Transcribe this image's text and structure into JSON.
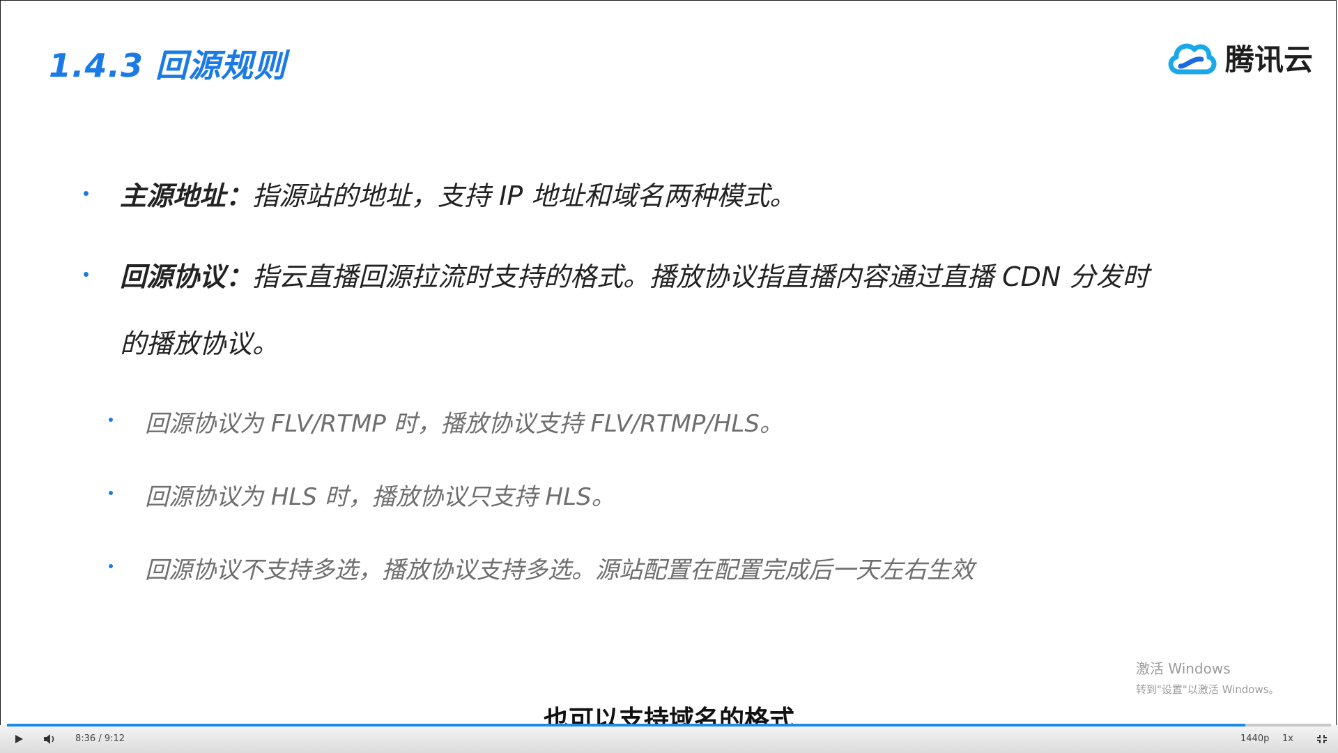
{
  "slide": {
    "title": "1.4.3  回源规则",
    "logo_text": "腾讯云",
    "bullets": [
      {
        "term": "主源地址：",
        "desc": "指源站的地址，支持 IP 地址和域名两种模式。"
      },
      {
        "term": "回源协议：",
        "desc": "指云直播回源拉流时支持的格式。播放协议指直播内容通过直播 CDN 分发时",
        "desc_cont": "的播放协议。"
      }
    ],
    "sub_bullets": [
      "回源协议为 FLV/RTMP 时，播放协议支持 FLV/RTMP/HLS。",
      "回源协议为 HLS 时，播放协议只支持 HLS。",
      "回源协议不支持多选，播放协议支持多选。源站配置在配置完成后一天左右生效"
    ]
  },
  "watermark": {
    "title": "激活 Windows",
    "subtitle": "转到\"设置\"以激活 Windows。"
  },
  "caption": "也可以支持域名的格式",
  "player": {
    "time": "8:36 / 9:12",
    "progress": 0.935,
    "quality": "1440p",
    "speed": "1x",
    "play_icon": "play-icon",
    "volume_icon": "volume-icon",
    "fullscreen_icon": "exit-fullscreen-icon",
    "accent_color": "#1c8be8"
  }
}
